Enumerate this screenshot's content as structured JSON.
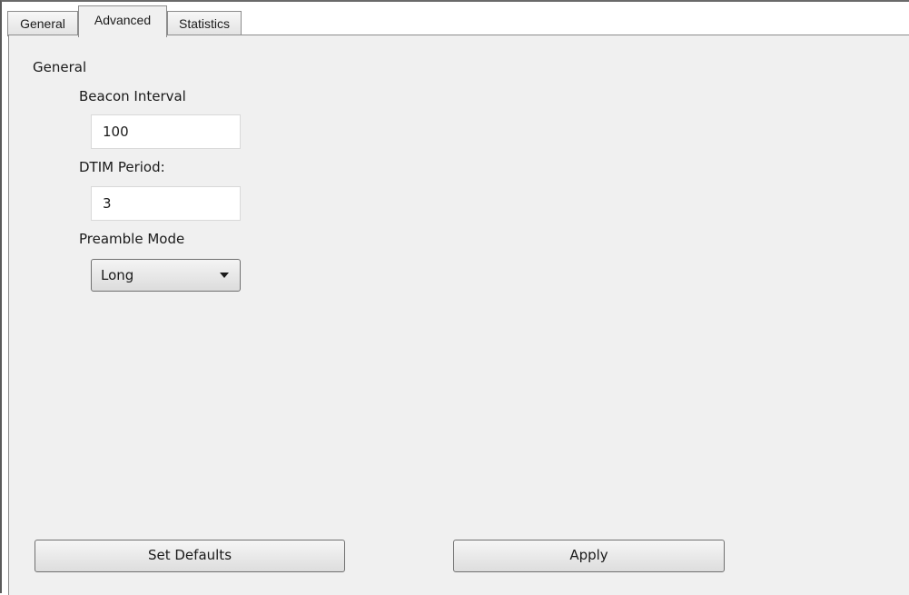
{
  "tabs": [
    {
      "label": "General",
      "active": false
    },
    {
      "label": "Advanced",
      "active": true
    },
    {
      "label": "Statistics",
      "active": false
    }
  ],
  "panel": {
    "group_label": "General",
    "beacon_interval": {
      "label": "Beacon Interval",
      "value": "100"
    },
    "dtim_period": {
      "label": "DTIM Period:",
      "value": "3"
    },
    "preamble_mode": {
      "label": "Preamble Mode",
      "selected": "Long"
    }
  },
  "buttons": {
    "set_defaults": "Set Defaults",
    "apply": "Apply"
  },
  "icons": {
    "dropdown": "chevron-down-icon"
  },
  "colors": {
    "panel_background": "#f0f0f0",
    "window_border": "#5a5a5a"
  }
}
